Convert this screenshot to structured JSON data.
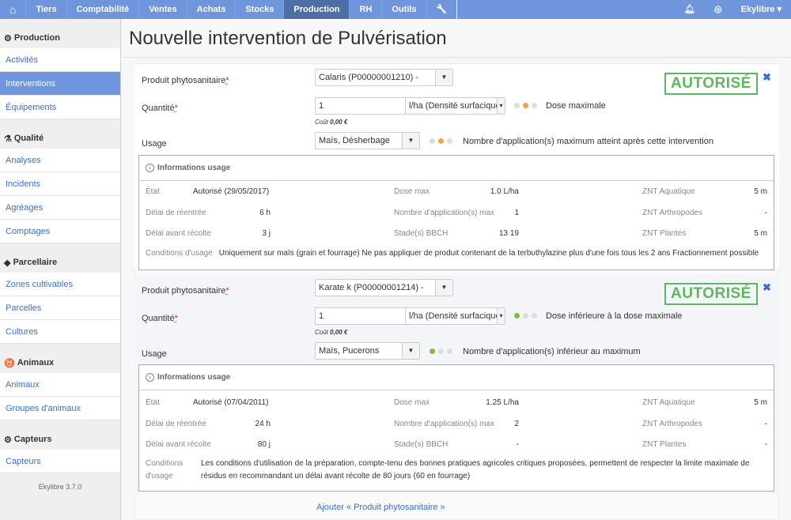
{
  "nav": {
    "items": [
      "Tiers",
      "Comptabilité",
      "Ventes",
      "Achats",
      "Stocks",
      "Production",
      "RH",
      "Outils"
    ],
    "active": "Production",
    "user": "Ekylibre ▾"
  },
  "sidebar": {
    "sections": [
      {
        "title": "Production",
        "icon": "gears-icon",
        "items": [
          "Activités",
          "Interventions",
          "Équipements"
        ]
      },
      {
        "title": "Qualité",
        "icon": "flask-icon",
        "items": [
          "Analyses",
          "Incidents",
          "Agréages",
          "Comptages"
        ]
      },
      {
        "title": "Parcellaire",
        "icon": "map-icon",
        "items": [
          "Zones cultivables",
          "Parcelles",
          "Cultures"
        ]
      },
      {
        "title": "Animaux",
        "icon": "cow-icon",
        "items": [
          "Animaux",
          "Groupes d'animaux"
        ]
      },
      {
        "title": "Capteurs",
        "icon": "gear-icon",
        "items": [
          "Capteurs"
        ]
      }
    ],
    "active": "Interventions",
    "version": "Ekylibre 3.7.0"
  },
  "page": {
    "title": "Nouvelle intervention de Pulvérisation",
    "add_link": "Ajouter « Produit phytosanitaire »"
  },
  "labels": {
    "product": "Produit phytosanitaire",
    "quantity": "Quantité",
    "usage": "Usage",
    "required": "*",
    "cost_prefix": "Coût ",
    "info_title": "Informations usage",
    "state": "État",
    "reentry": "Délai de réentrée",
    "preharvest": "Délai avant récolte",
    "dose_max": "Dose max",
    "app_max": "Nombre d'application(s) max",
    "bbch": "Stade(s) BBCH",
    "znt_aqua": "ZNT Aquatique",
    "znt_arthro": "ZNT Arthropodes",
    "znt_plants": "ZNT Plantes",
    "conditions": "Conditions d'usage"
  },
  "blocks": [
    {
      "product": "Calaris (P00000001210) -",
      "quantity": "1",
      "unit": "l/ha (Densité surfacique)",
      "cost": "0,00 €",
      "dose_status": "Dose maximale",
      "dose_light": 1,
      "dose_color": "#f5a33a",
      "usage": "Maïs, Désherbage",
      "usage_status": "Nombre d'application(s) maximum atteint après cette intervention",
      "usage_light": 1,
      "usage_color": "#f5a33a",
      "badge": "AUTORISÉ",
      "state": "Autorisé (29/05/2017)",
      "reentry": "6 h",
      "preharvest": "3 j",
      "dose_max": "1.0 L/ha",
      "app_max": "1",
      "bbch": "13 19",
      "znt_aqua": "5 m",
      "znt_arthro": "-",
      "znt_plants": "5 m",
      "conditions": "Uniquement sur maïs (grain et fourrage) Ne pas appliquer de produit contenant de la terbuthylazine plus d'une fois tous les 2 ans Fractionnement possible"
    },
    {
      "product": "Karate k (P00000001214) -",
      "quantity": "1",
      "unit": "l/ha (Densité surfacique)",
      "cost": "0,00 €",
      "dose_status": "Dose inférieure à la dose maximale",
      "dose_light": 0,
      "dose_color": "#7cc03c",
      "usage": "Maïs, Pucerons",
      "usage_status": "Nombre d'application(s) inférieur au maximum",
      "usage_light": 0,
      "usage_color": "#7cc03c",
      "badge": "AUTORISÉ",
      "state": "Autorisé (07/04/2011)",
      "reentry": "24 h",
      "preharvest": "80 j",
      "dose_max": "1.25 L/ha",
      "app_max": "2",
      "bbch": "-",
      "znt_aqua": "5 m",
      "znt_arthro": "-",
      "znt_plants": "-",
      "conditions": "Les conditions d'utilisation de la préparation, compte-tenu des bonnes pratiques agricoles critiques proposées, permettent de respecter la limite maximale de résidus en recommandant un délai avant récolte de 80 jours (60 en fourrage)"
    }
  ]
}
